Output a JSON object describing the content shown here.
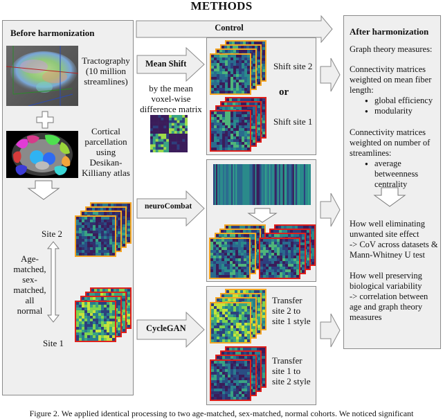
{
  "title": "METHODS",
  "before": {
    "heading": "Before harmonization",
    "tractography_label": "Tractography (10 million streamlines)",
    "tractography_lines": [
      "Tractography",
      "(10 million",
      "streamlines)"
    ],
    "parcellation_lines": [
      "Cortical",
      "parcellation",
      "using",
      "Desikan-",
      "Killiany atlas"
    ],
    "site2": "Site 2",
    "site1": "Site 1",
    "cohort_lines": [
      "Age-",
      "matched,",
      "sex-",
      "matched,",
      "all",
      "normal"
    ]
  },
  "control": {
    "label": "Control"
  },
  "mean_shift": {
    "label": "Mean Shift",
    "desc_lines": [
      "by the mean",
      "voxel-wise",
      "difference matrix"
    ],
    "shift_site2": "Shift site 2",
    "or": "or",
    "shift_site1": "Shift site 1"
  },
  "neurocombat": {
    "label": "neuroCombat"
  },
  "cyclegan": {
    "label": "CycleGAN",
    "transfer_2_lines": [
      "Transfer",
      "site 2 to",
      "site 1 style"
    ],
    "transfer_1_lines": [
      "Transfer",
      "site 1 to",
      "site 2 style"
    ]
  },
  "after": {
    "heading": "After harmonization",
    "graph_measures": "Graph theory measures:",
    "fiber_length_lines": [
      "Connectivity matrices",
      "weighted on mean fiber",
      "length:"
    ],
    "fiber_length_bullets": [
      "global efficiency",
      "modularity"
    ],
    "streamlines_lines": [
      "Connectivity matrices",
      "weighted on number of",
      "streamlines:"
    ],
    "streamlines_bullets": [
      "average betweenness",
      "centrality"
    ],
    "eliminating_lines": [
      "How well eliminating",
      "unwanted site effect",
      "-> CoV across datasets &",
      "Mann-Whitney U test"
    ],
    "preserving_lines": [
      "How well preserving",
      "biological variability",
      "-> correlation between",
      "age and graph theory",
      "measures"
    ]
  },
  "colors": {
    "site2_border": "#f5a623",
    "site1_border": "#e0201b",
    "panel_bg": "#efefef",
    "panel_border": "#8a8a8a",
    "matrix_dark": "#3b1c5a",
    "matrix_mid": "#2a7d8e",
    "matrix_light": "#7fd34e"
  },
  "caption": "Figure 2. We applied identical processing to two age-matched, sex-matched, normal cohorts. We noticed significant"
}
